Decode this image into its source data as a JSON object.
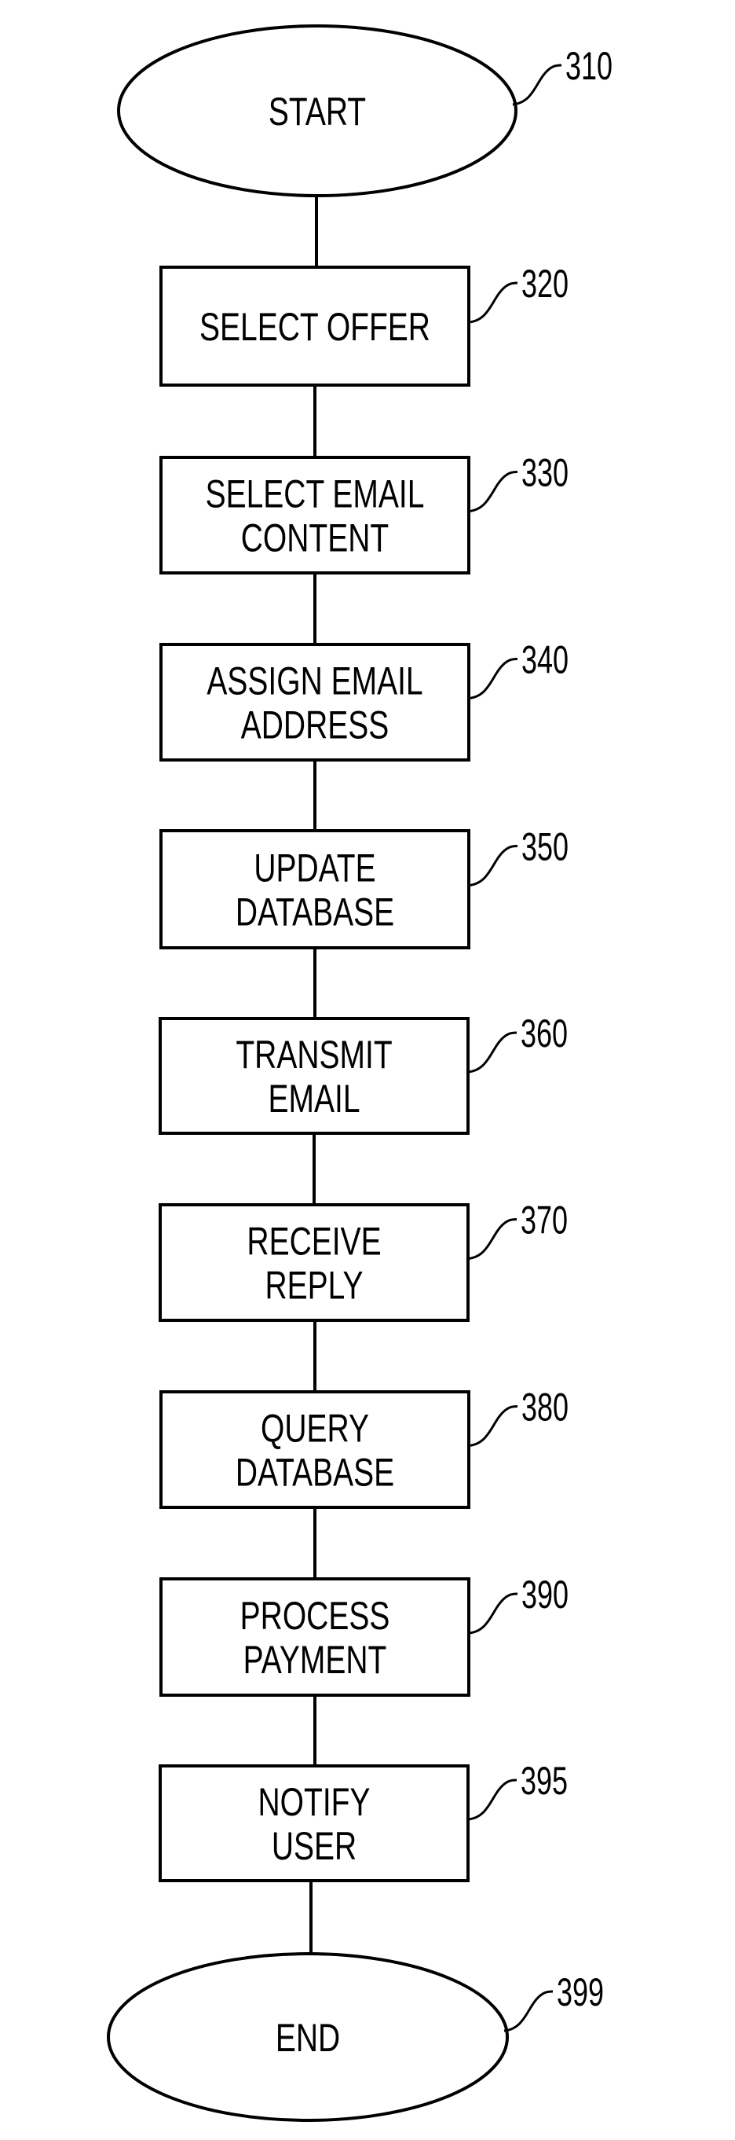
{
  "diagram": {
    "type": "flowchart",
    "direction": "top-to-bottom",
    "colors": {
      "stroke": "#000000",
      "background": "#ffffff"
    },
    "nodes": [
      {
        "id": "310",
        "shape": "ellipse",
        "lines": [
          "START"
        ]
      },
      {
        "id": "320",
        "shape": "rect",
        "lines": [
          "SELECT OFFER"
        ]
      },
      {
        "id": "330",
        "shape": "rect",
        "lines": [
          "SELECT EMAIL",
          "CONTENT"
        ]
      },
      {
        "id": "340",
        "shape": "rect",
        "lines": [
          "ASSIGN EMAIL",
          "ADDRESS"
        ]
      },
      {
        "id": "350",
        "shape": "rect",
        "lines": [
          "UPDATE",
          "DATABASE"
        ]
      },
      {
        "id": "360",
        "shape": "rect",
        "lines": [
          "TRANSMIT",
          "EMAIL"
        ]
      },
      {
        "id": "370",
        "shape": "rect",
        "lines": [
          "RECEIVE",
          "REPLY"
        ]
      },
      {
        "id": "380",
        "shape": "rect",
        "lines": [
          "QUERY",
          "DATABASE"
        ]
      },
      {
        "id": "390",
        "shape": "rect",
        "lines": [
          "PROCESS",
          "PAYMENT"
        ]
      },
      {
        "id": "395",
        "shape": "rect",
        "lines": [
          "NOTIFY",
          "USER"
        ]
      },
      {
        "id": "399",
        "shape": "ellipse",
        "lines": [
          "END"
        ]
      }
    ],
    "edges": [
      [
        "310",
        "320"
      ],
      [
        "320",
        "330"
      ],
      [
        "330",
        "340"
      ],
      [
        "340",
        "350"
      ],
      [
        "350",
        "360"
      ],
      [
        "360",
        "370"
      ],
      [
        "370",
        "380"
      ],
      [
        "380",
        "390"
      ],
      [
        "390",
        "395"
      ],
      [
        "395",
        "399"
      ]
    ]
  }
}
